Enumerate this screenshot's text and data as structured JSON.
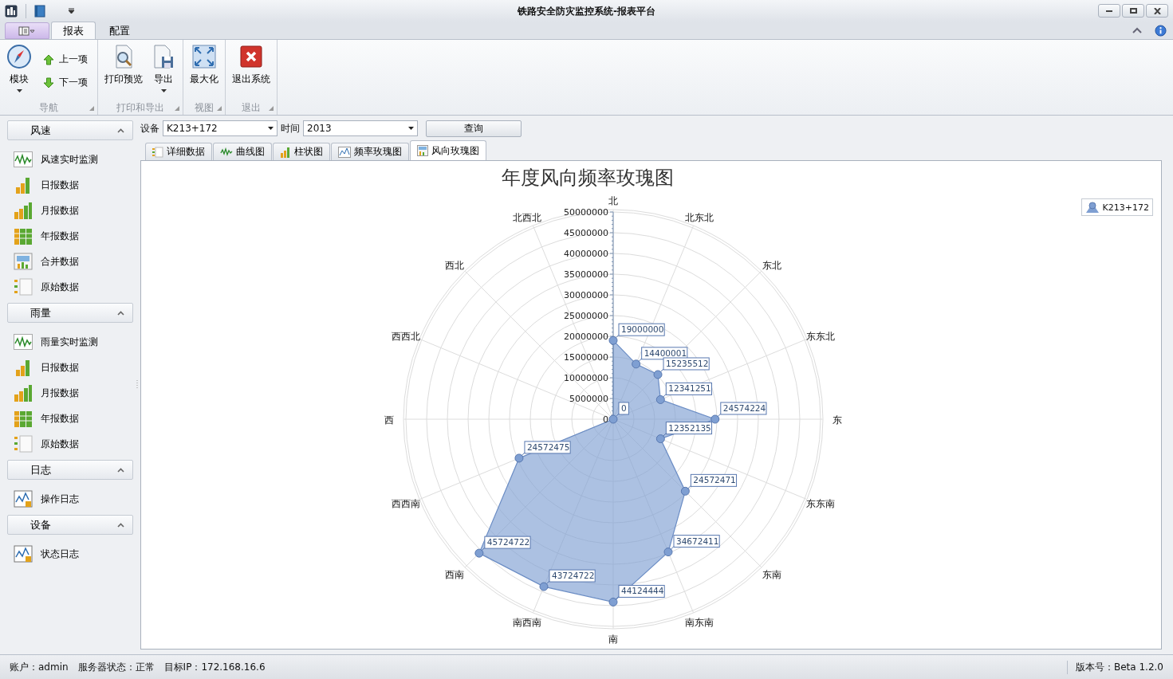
{
  "window": {
    "title": "铁路安全防灾监控系统-报表平台"
  },
  "ribbon": {
    "tabs": [
      {
        "label": "报表",
        "selected": true
      },
      {
        "label": "配置",
        "selected": false
      }
    ],
    "groups": [
      {
        "label": "导航",
        "buttons": [
          {
            "label": "模块",
            "kind": "module",
            "dropdown": true
          },
          {
            "label": "上一项",
            "kind": "previous",
            "dropdown": false
          },
          {
            "label": "下一项",
            "kind": "next",
            "dropdown": false
          }
        ]
      },
      {
        "label": "打印和导出",
        "buttons": [
          {
            "label": "打印预览",
            "kind": "preview",
            "dropdown": false
          },
          {
            "label": "导出",
            "kind": "export",
            "dropdown": true
          }
        ]
      },
      {
        "label": "视图",
        "buttons": [
          {
            "label": "最大化",
            "kind": "maximize",
            "dropdown": false
          }
        ]
      },
      {
        "label": "退出",
        "buttons": [
          {
            "label": "退出系统",
            "kind": "exit",
            "dropdown": false
          }
        ]
      }
    ]
  },
  "sidebar": {
    "groups": [
      {
        "title": "风速",
        "expanded": true,
        "items": [
          {
            "label": "风速实时监测",
            "kind": "realtime"
          },
          {
            "label": "日报数据",
            "kind": "daily"
          },
          {
            "label": "月报数据",
            "kind": "monthly"
          },
          {
            "label": "年报数据",
            "kind": "yearly"
          },
          {
            "label": "合并数据",
            "kind": "merged"
          },
          {
            "label": "原始数据",
            "kind": "raw"
          }
        ]
      },
      {
        "title": "雨量",
        "expanded": true,
        "items": [
          {
            "label": "雨量实时监测",
            "kind": "realtime"
          },
          {
            "label": "日报数据",
            "kind": "daily"
          },
          {
            "label": "月报数据",
            "kind": "monthly"
          },
          {
            "label": "年报数据",
            "kind": "yearly"
          },
          {
            "label": "原始数据",
            "kind": "raw"
          }
        ]
      },
      {
        "title": "日志",
        "expanded": true,
        "items": [
          {
            "label": "操作日志",
            "kind": "log"
          }
        ]
      },
      {
        "title": "设备",
        "expanded": true,
        "items": [
          {
            "label": "状态日志",
            "kind": "log"
          }
        ]
      }
    ]
  },
  "filter": {
    "device_label": "设备",
    "device": "K213+172",
    "time_label": "时间",
    "time": "2013",
    "query_button": "查询"
  },
  "tabs": [
    {
      "label": "详细数据",
      "kind": "raw",
      "selected": false
    },
    {
      "label": "曲线图",
      "kind": "realtime",
      "selected": false
    },
    {
      "label": "柱状图",
      "kind": "daily",
      "selected": false
    },
    {
      "label": "频率玫瑰图",
      "kind": "log",
      "selected": false
    },
    {
      "label": "风向玫瑰图",
      "kind": "merged",
      "selected": true
    }
  ],
  "rose_chart": {
    "title": "年度风向频率玫瑰图",
    "legend": "K213+172",
    "scale_labels": [
      "50000000",
      "45000000",
      "40000000",
      "35000000",
      "30000000",
      "25000000",
      "20000000",
      "15000000",
      "10000000",
      "5000000",
      "0"
    ],
    "directions": [
      "北",
      "北东北",
      "东北",
      "东东北",
      "东",
      "东东南",
      "东南",
      "南东南",
      "南",
      "南西南",
      "西南",
      "西西南",
      "西",
      "西西北",
      "西北",
      "北西北"
    ],
    "point_values": [
      "19000000",
      "14400001",
      "15235512",
      "12341251",
      "24574224",
      "12352135",
      "24572471",
      "34672411",
      "44124444",
      "43724722",
      "45724722",
      "24572475",
      "0"
    ]
  },
  "status_bar": {
    "account": "账户：admin",
    "server": "服务器状态：正常",
    "target_ip": "目标IP：172.168.16.6",
    "version": "版本号：Beta 1.2.0"
  }
}
